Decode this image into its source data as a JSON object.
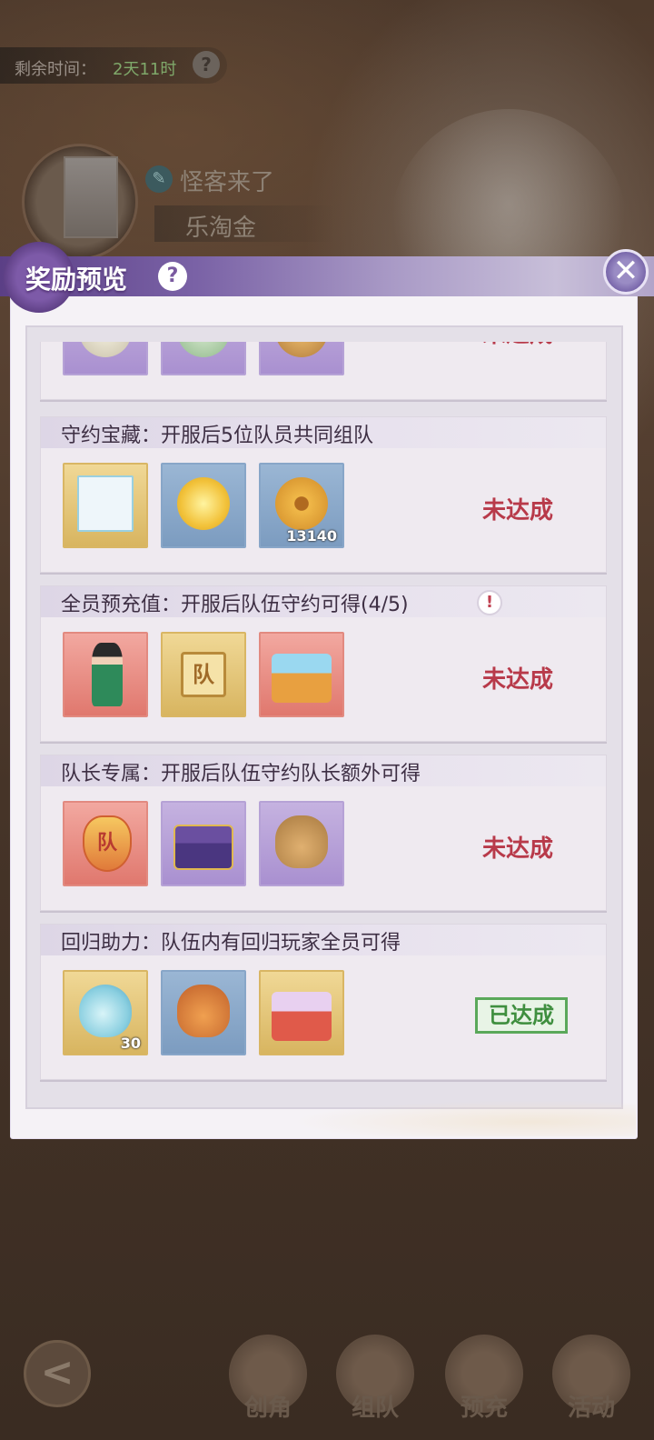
{
  "background": {
    "timer_label": "剩余时间：",
    "timer_value": "2天11时",
    "timer_help": "?",
    "player_name": "怪客来了",
    "server_name": "乐淘金",
    "guild_icon": "feather-icon"
  },
  "modal": {
    "title": "奖励预览",
    "help": "?",
    "close": "✕"
  },
  "cards": [
    {
      "title": "",
      "items": [
        {
          "icon": "scroll-icon",
          "tier": "purple",
          "qty": ""
        },
        {
          "icon": "map-scroll-icon",
          "tier": "purple",
          "qty": ""
        },
        {
          "icon": "money-bag-icon",
          "tier": "purple",
          "qty": ""
        }
      ],
      "status": "未达成",
      "achieved": false
    },
    {
      "title": "守约宝藏：开服后5位队员共同组队",
      "items": [
        {
          "icon": "photo-frame-icon",
          "tier": "gold",
          "qty": ""
        },
        {
          "icon": "yellow-flower-icon",
          "tier": "blue",
          "qty": ""
        },
        {
          "icon": "copper-coin-icon",
          "tier": "blue",
          "qty": "13140"
        }
      ],
      "status": "未达成",
      "achieved": false
    },
    {
      "title": "全员预充值：开服后队伍守约可得(4/5)",
      "warn": "!",
      "items": [
        {
          "icon": "outfit-icon",
          "tier": "red",
          "qty": ""
        },
        {
          "icon": "team-badge-icon",
          "tier": "gold",
          "qty": "",
          "text": "队"
        },
        {
          "icon": "gift-chest-icon",
          "tier": "red",
          "qty": ""
        }
      ],
      "status": "未达成",
      "achieved": false
    },
    {
      "title": "队长专属：开服后队伍守约队长额外可得",
      "items": [
        {
          "icon": "captain-emblem-icon",
          "tier": "red",
          "qty": "",
          "text": "队"
        },
        {
          "icon": "treasure-chest-icon",
          "tier": "purple",
          "qty": ""
        },
        {
          "icon": "money-bag-icon",
          "tier": "purple",
          "qty": ""
        }
      ],
      "status": "未达成",
      "achieved": false
    },
    {
      "title": "回归助力：队伍内有回归玩家全员可得",
      "items": [
        {
          "icon": "potion-bottle-icon",
          "tier": "gold",
          "qty": "30"
        },
        {
          "icon": "star-bag-icon",
          "tier": "blue",
          "qty": ""
        },
        {
          "icon": "gift-box-icon",
          "tier": "gold",
          "qty": ""
        }
      ],
      "status": "已达成",
      "achieved": true
    }
  ],
  "nav": [
    {
      "label": "创角"
    },
    {
      "label": "组队"
    },
    {
      "label": "预充"
    },
    {
      "label": "活动"
    }
  ],
  "colors": {
    "pending": "#b83a4a",
    "done": "#3f8f3f",
    "header_purple": "#5b3f86"
  }
}
